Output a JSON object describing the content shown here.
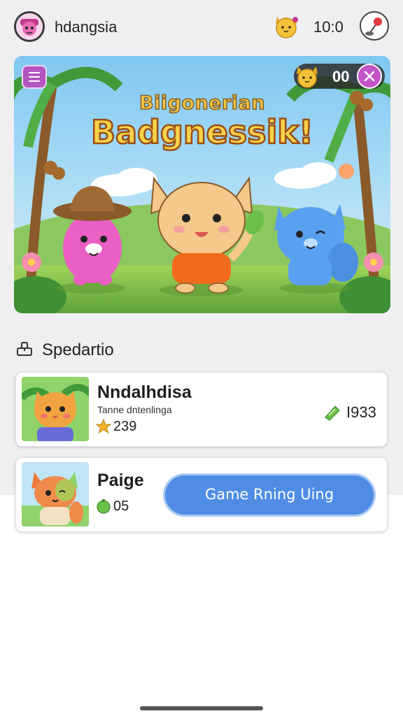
{
  "header": {
    "username": "hdangsia",
    "time": "10:0",
    "icons": {
      "avatar": "avatar-icon",
      "coin": "cat-coin-icon",
      "settings": "joystick-icon"
    }
  },
  "banner": {
    "subtitle": "Biigonerian",
    "title": "Badgnessik!",
    "score": "00",
    "icons": {
      "menu": "hamburger-menu-icon",
      "score": "cat-face-icon",
      "close": "close-icon"
    }
  },
  "section": {
    "label": "Spedartio",
    "icon": "badge-icon"
  },
  "cards": [
    {
      "title": "Nndalhdisa",
      "subtitle": "Tanne dntenlinga",
      "stat_value": "239",
      "stat_icon": "star-icon",
      "right_value": "I933",
      "right_icon": "gem-icon"
    },
    {
      "title": "Paige",
      "stat_value": "05",
      "stat_icon": "green-gem-icon",
      "button_label": "Game Rning Uing"
    }
  ],
  "colors": {
    "accent_blue": "#4f8de4",
    "menu_purple": "#b455c2",
    "title_yellow": "#f7d24a",
    "background": "#efeff2"
  }
}
